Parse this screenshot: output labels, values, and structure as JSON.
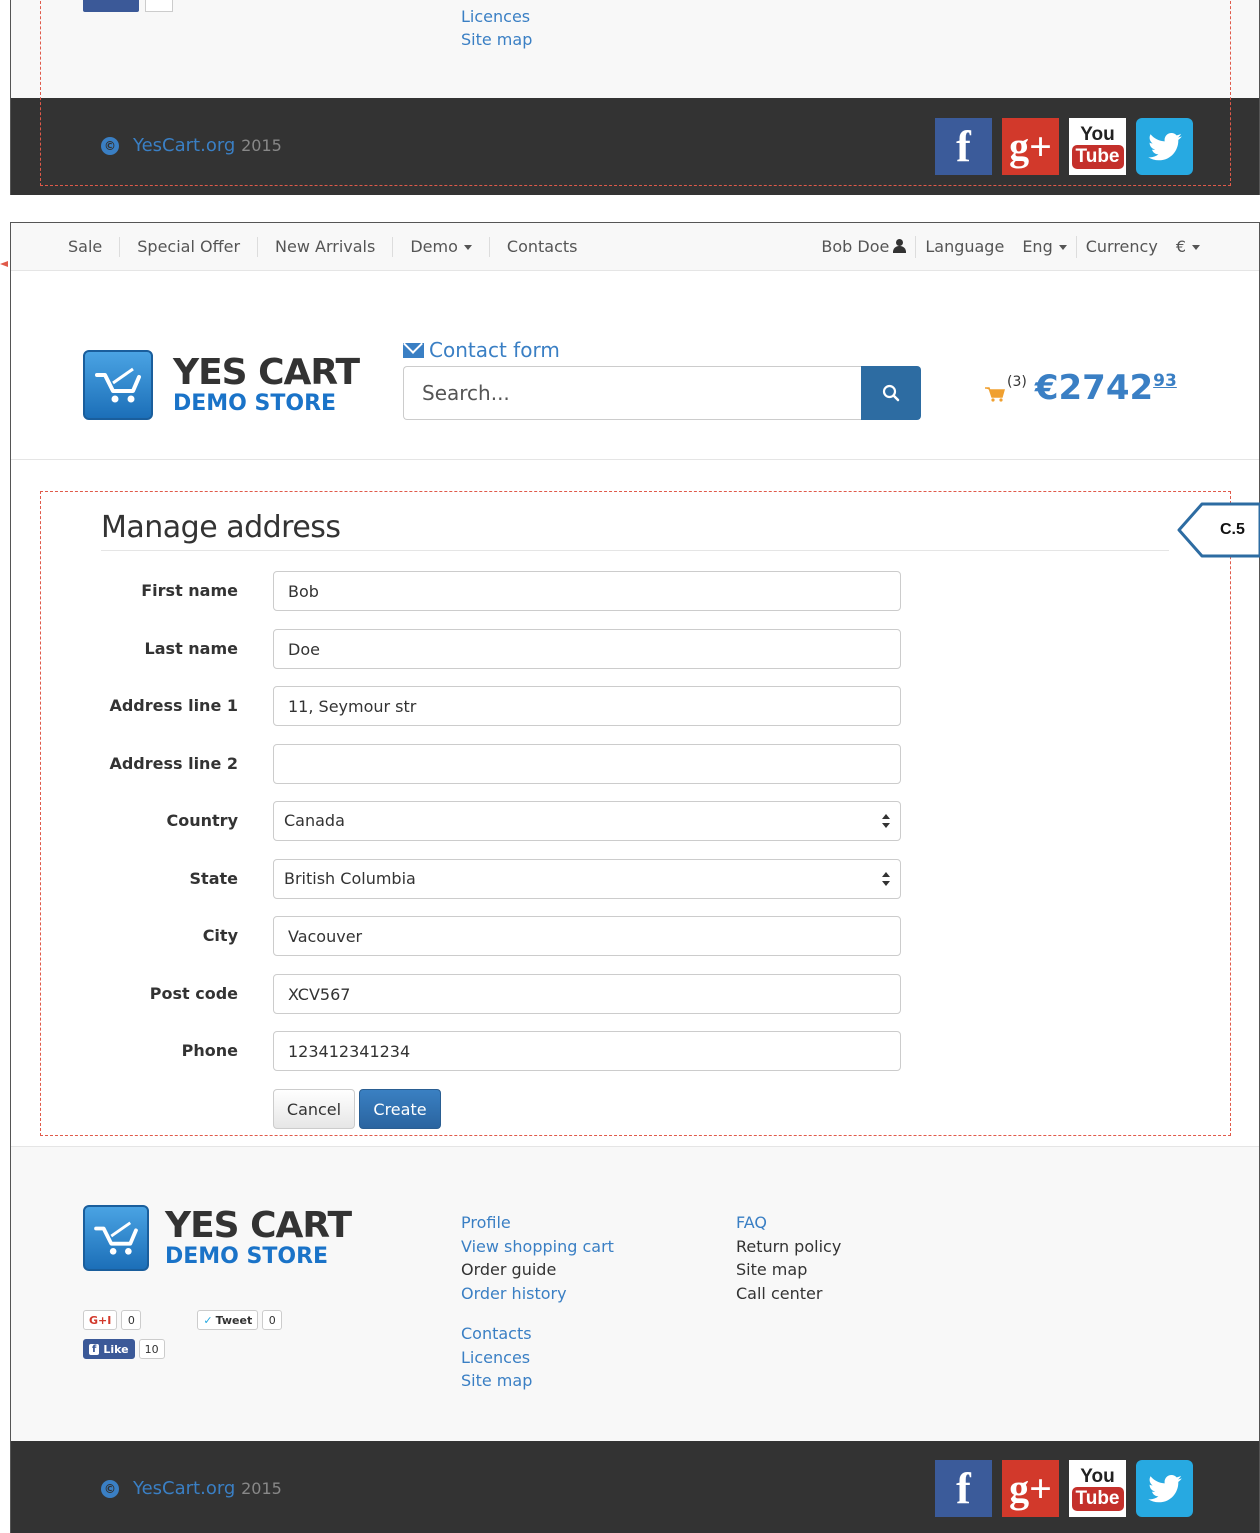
{
  "top_fragment": {
    "links": [
      "Licences",
      "Site map"
    ]
  },
  "footer_bar": {
    "site": "YesCart.org",
    "year": "2015",
    "copyright_icon": "copyright-icon",
    "social": [
      {
        "name": "facebook-icon",
        "label": "f"
      },
      {
        "name": "google-plus-icon",
        "label": "g+"
      },
      {
        "name": "youtube-icon",
        "label_you": "You",
        "label_tube": "Tube"
      },
      {
        "name": "twitter-icon",
        "label": ""
      }
    ]
  },
  "navbar": {
    "left": [
      {
        "label": "Sale"
      },
      {
        "label": "Special Offer"
      },
      {
        "label": "New Arrivals"
      },
      {
        "label": "Demo",
        "dropdown": true
      },
      {
        "label": "Contacts"
      }
    ],
    "user": "Bob Doe",
    "language_label": "Language",
    "language_value": "Eng",
    "currency_label": "Currency",
    "currency_value": "€"
  },
  "header": {
    "logo_line1": "YES CART",
    "logo_line2": "DEMO STORE",
    "contact_link": "Contact form",
    "search_placeholder": "Search...",
    "cart_count": "(3)",
    "cart_currency": "€",
    "cart_amount": "2742",
    "cart_cents": "93"
  },
  "form": {
    "title": "Manage address",
    "fields": [
      {
        "label": "First name",
        "value": "Bob",
        "type": "text"
      },
      {
        "label": "Last name",
        "value": "Doe",
        "type": "text"
      },
      {
        "label": "Address line 1",
        "value": "11, Seymour str",
        "type": "text"
      },
      {
        "label": "Address line 2",
        "value": "",
        "type": "text"
      },
      {
        "label": "Country",
        "value": "Canada",
        "type": "select"
      },
      {
        "label": "State",
        "value": "British Columbia",
        "type": "select"
      },
      {
        "label": "City",
        "value": "Vacouver",
        "type": "text"
      },
      {
        "label": "Post code",
        "value": "XCV567",
        "type": "text"
      },
      {
        "label": "Phone",
        "value": "123412341234",
        "type": "text"
      }
    ],
    "cancel_label": "Cancel",
    "create_label": "Create"
  },
  "callout": {
    "label": "C.5"
  },
  "footer": {
    "logo_line1": "YES CART",
    "logo_line2": "DEMO STORE",
    "col1a": [
      {
        "label": "Profile",
        "link": true
      },
      {
        "label": "View shopping cart",
        "link": true
      },
      {
        "label": "Order guide",
        "link": false
      },
      {
        "label": "Order history",
        "link": true
      }
    ],
    "col1b": [
      {
        "label": "Contacts",
        "link": true
      },
      {
        "label": "Licences",
        "link": true
      },
      {
        "label": "Site map",
        "link": true
      }
    ],
    "col2": [
      {
        "label": "FAQ",
        "link": true
      },
      {
        "label": "Return policy",
        "link": false
      },
      {
        "label": "Site map",
        "link": false
      },
      {
        "label": "Call center",
        "link": false
      }
    ],
    "share": {
      "gplus_label": "G+I",
      "gplus_count": "0",
      "tweet_label": "Tweet",
      "tweet_count": "0",
      "like_label": "Like",
      "like_count": "10"
    }
  },
  "colors": {
    "accent": "#3a7fc4",
    "footer_bar": "#333333",
    "annotation": "#e05a4a",
    "primary_button": "#2d6ca2"
  }
}
